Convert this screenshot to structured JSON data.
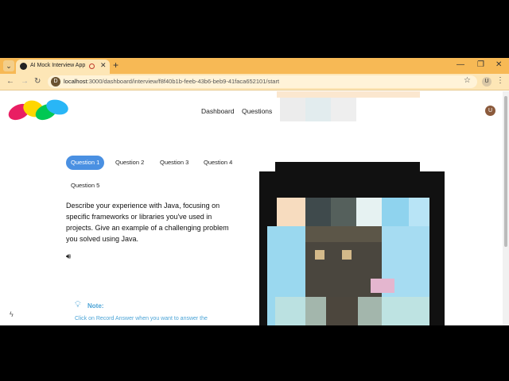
{
  "browser": {
    "tab_title": "AI Mock Interview App",
    "url_host": "localhost",
    "url_rest": ":3000/dashboard/interview/f8f40b1b-feeb-43b6-beb9-41faca652101/start",
    "site_icon_letter": "D",
    "profile_letter": "U"
  },
  "header": {
    "nav": [
      "Dashboard",
      "Questions"
    ],
    "avatar_letter": "U"
  },
  "questions": {
    "tabs": [
      "Question 1",
      "Question 2",
      "Question 3",
      "Question 4",
      "Question 5"
    ],
    "active_index": 0,
    "current_text": "Describe your experience with Java, focusing on specific frameworks or libraries you've used in projects. Give an example of a challenging problem you solved using Java."
  },
  "note": {
    "title": "Note:",
    "text": "Click on Record Answer when you want to answer the"
  },
  "colors": {
    "tab_bar": "#f7b955",
    "accent": "#4a90e2",
    "note": "#4aa3d6"
  }
}
